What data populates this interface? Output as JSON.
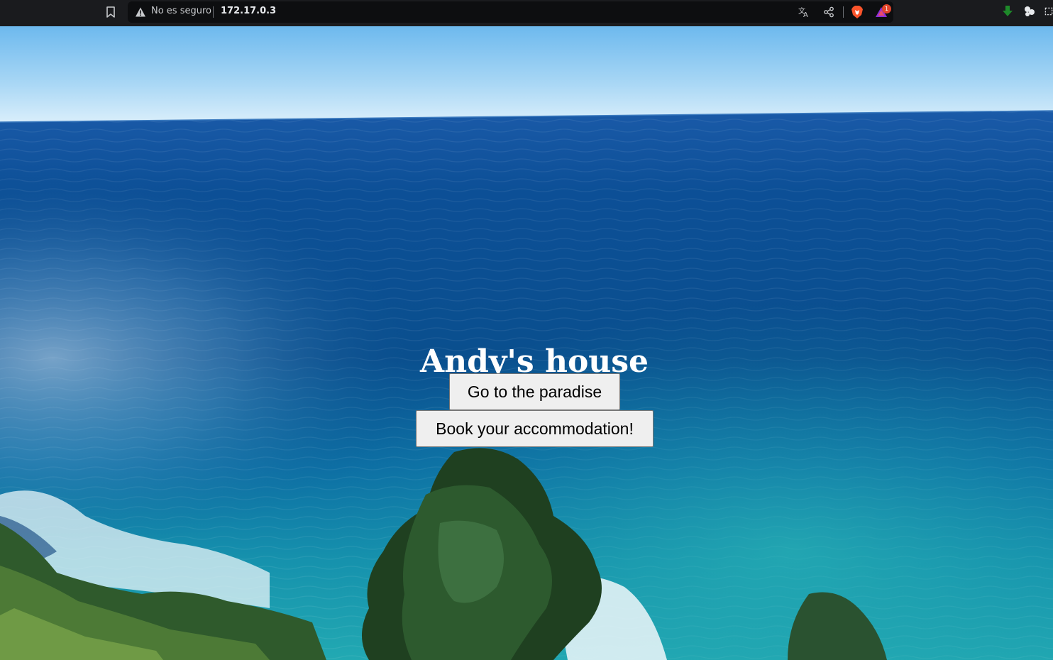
{
  "browser": {
    "security_label": "No es seguro",
    "url": "172.17.0.3",
    "rewards_badge_count": "1",
    "icons": {
      "bookmark": "bookmark-icon",
      "security": "warning-triangle-icon",
      "translate": "translate-icon",
      "share": "share-icon",
      "shield": "brave-shield-icon",
      "rewards": "brave-rewards-icon",
      "download": "download-arrow-icon",
      "extensions": "extensions-icon"
    }
  },
  "hero": {
    "title": "Andy's house",
    "buttons": {
      "paradise_label": "Go to the paradise",
      "accommodation_label": "Book your accommodation!"
    }
  },
  "colors": {
    "sky_top": "#7cc0f0",
    "sea_deep": "#0a4e8e",
    "sea_shallow": "#1aa3b0",
    "button_bg": "#efefef",
    "title_text": "#ffffff"
  }
}
